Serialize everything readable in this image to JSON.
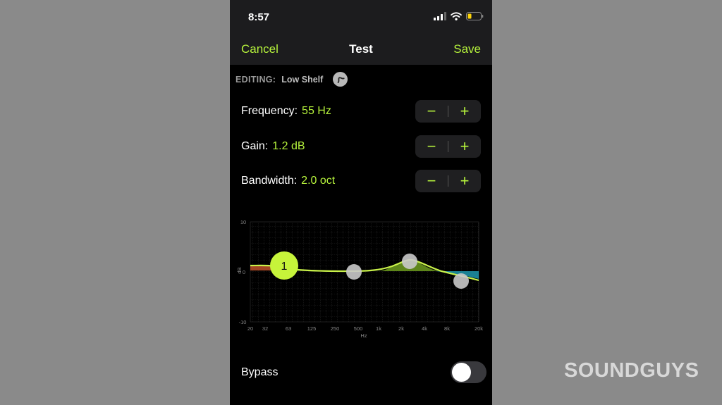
{
  "status_bar": {
    "time": "8:57"
  },
  "nav": {
    "cancel": "Cancel",
    "title": "Test",
    "save": "Save"
  },
  "editing": {
    "label": "EDITING:",
    "value": "Low Shelf"
  },
  "params": [
    {
      "label": "Frequency:",
      "value": "55 Hz",
      "minus": "−",
      "plus": "+"
    },
    {
      "label": "Gain:",
      "value": "1.2 dB",
      "minus": "−",
      "plus": "+"
    },
    {
      "label": "Bandwidth:",
      "value": "2.0 oct",
      "minus": "−",
      "plus": "+"
    }
  ],
  "graph": {
    "y_ticks": [
      "10",
      "0",
      "-10"
    ],
    "y_label": "dB",
    "x_ticks": [
      "20",
      "32",
      "63",
      "125",
      "250",
      "500",
      "1k",
      "2k",
      "4k",
      "8k",
      "20k"
    ],
    "x_label": "Hz",
    "active_node_label": "1"
  },
  "bypass": {
    "label": "Bypass",
    "on": false
  },
  "watermark": "SOUNDGUYS",
  "colors": {
    "accent": "#b6f33c",
    "background": "#000000",
    "bar": "#1c1c1e",
    "stepper": "#1f1f21"
  },
  "icons": [
    "signal-icon",
    "wifi-icon",
    "battery-icon",
    "low-shelf-filter-icon",
    "minus-icon",
    "plus-icon"
  ]
}
